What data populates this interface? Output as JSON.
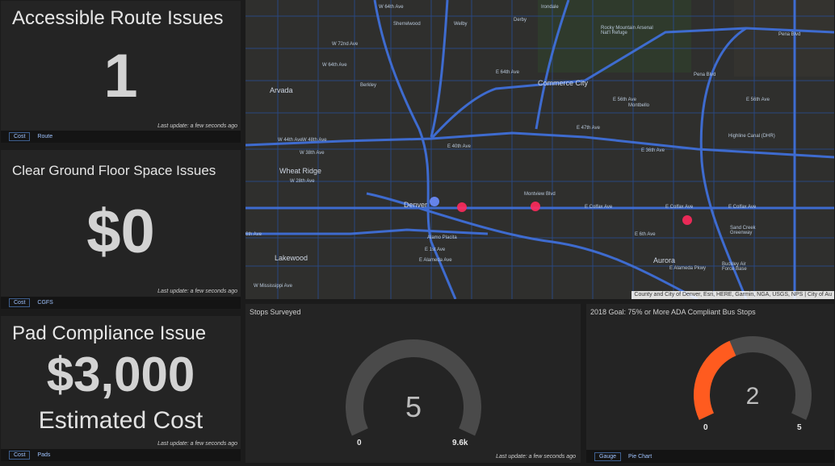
{
  "cards": [
    {
      "title": "Accessible Route Issues",
      "value": "1",
      "update": "Last update: a few seconds ago",
      "tabs": [
        "Cost",
        "Route"
      ]
    },
    {
      "title": "Clear Ground Floor Space Issues",
      "value": "$0",
      "update": "Last update: a few seconds ago",
      "tabs": [
        "Cost",
        "CGFS"
      ]
    },
    {
      "title": "Pad Compliance Issue",
      "value": "$3,000",
      "subtitle": "Estimated Cost",
      "update": "Last update: a few seconds ago",
      "tabs": [
        "Cost",
        "Pads"
      ]
    }
  ],
  "map": {
    "labels": {
      "w64": "W 64th Ave",
      "sherrelwood": "Sherrelwood",
      "welby": "Welby",
      "derby": "Derby",
      "irondale": "Irondale",
      "w72": "W 72nd Ave",
      "w64b": "W 64th Ave",
      "e64": "E 64th Ave",
      "berkley": "Berkley",
      "arvada": "Arvada",
      "commerce": "Commerce City",
      "e56": "E 56th Ave",
      "e56b": "E 56th Ave",
      "montbello": "Montbello",
      "w48": "W 48th Ave",
      "e47": "E 47th Ave",
      "w44": "W 44th Ave",
      "e40": "E 40th Ave",
      "w38": "W 38th Ave",
      "wheatridge": "Wheat Ridge",
      "w28": "W 28th Ave",
      "denver": "Denver",
      "montview": "Montview Blvd",
      "colfax": "E Colfax Ave",
      "colfax2": "E Colfax Ave",
      "colfax3": "E Colfax Ave",
      "sixth": "6th Ave",
      "e6": "E 6th Ave",
      "alamo": "Alamo Placita",
      "e1st": "E 1st Ave",
      "ealameda": "E Alameda Ave",
      "lakewood": "Lakewood",
      "aurora": "Aurora",
      "ealameda2": "E Alameda Pkwy",
      "wmiss": "W Mississippi Ave",
      "rma": "Rocky Mountain Arsenal Nat'l Refuge",
      "pena": "Pena Blvd",
      "pena2": "Pena Blvd",
      "highline": "Highline Canal (DHR)",
      "sandcreek": "Sand Creek Greenway",
      "buckley": "Buckley Air Force Base",
      "e36": "E 36th Ave"
    },
    "attribution": "County and City of Denver, Esri, HERE, Garmin, NGA, USGS, NPS | City of Au"
  },
  "gauges": [
    {
      "title": "Stops Surveyed",
      "value": "5",
      "min": "0",
      "max": "9.6k",
      "current": 5,
      "maximum": 9600,
      "update": "Last update: a few seconds ago"
    },
    {
      "title": "2018 Goal: 75% or More ADA Compliant Bus Stops",
      "value": "2",
      "min": "0",
      "max": "5",
      "current": 2,
      "maximum": 5,
      "tabs": [
        "Gauge",
        "Pie Chart"
      ]
    }
  ],
  "colors": {
    "accent": "#ff5b1f",
    "gauge_bg": "#4a4a4a",
    "road": "#3f6fd8",
    "marker_red": "#ff2a5c",
    "marker_blue": "#6b8dff"
  }
}
